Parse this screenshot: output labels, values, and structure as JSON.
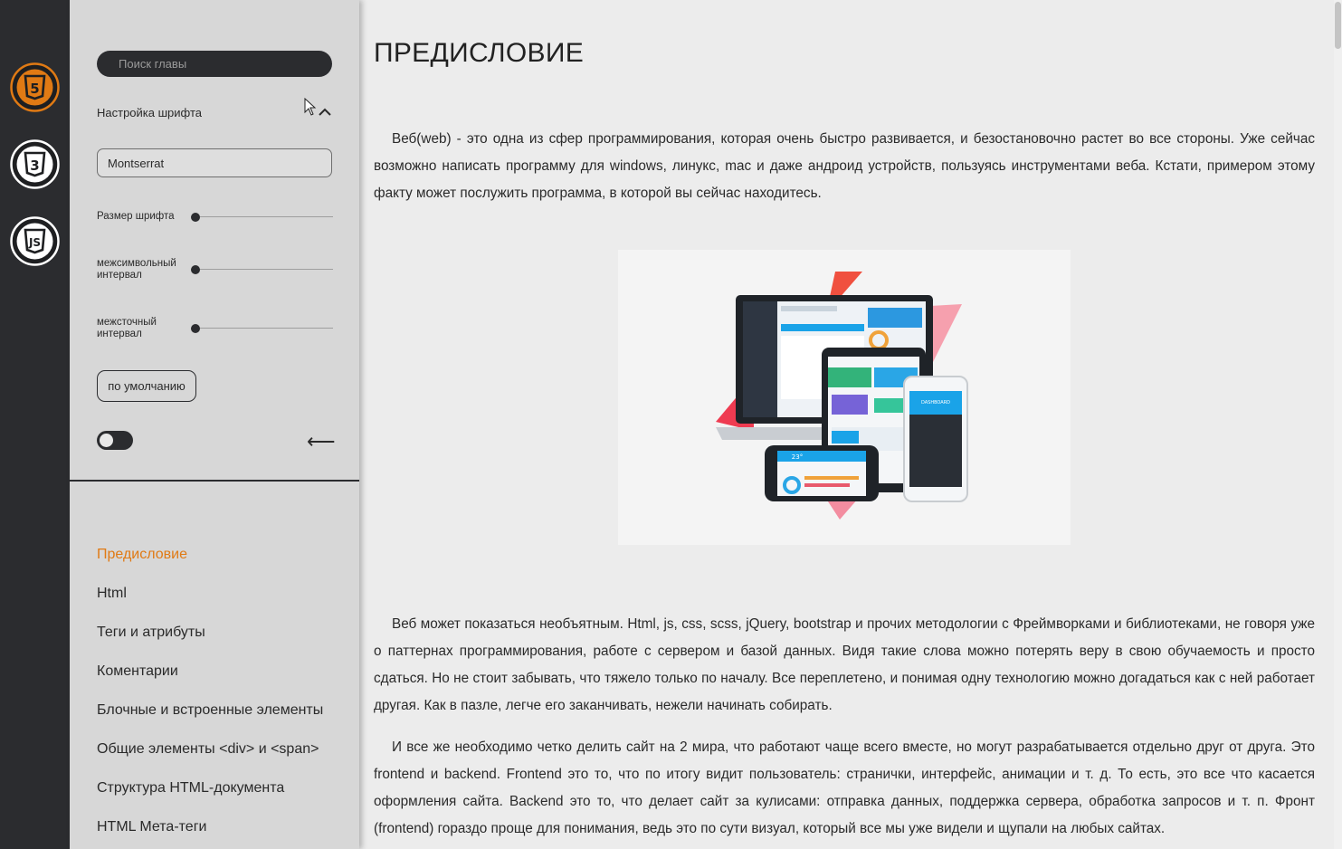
{
  "rail": {
    "icons": [
      {
        "name": "html5-icon",
        "label": "5",
        "color": "#e07a14"
      },
      {
        "name": "css3-icon",
        "label": "3",
        "color": "#ffffff"
      },
      {
        "name": "javascript-icon",
        "label": "JS",
        "color": "#ffffff"
      }
    ]
  },
  "panel": {
    "search_placeholder": "Поиск главы",
    "font_settings_label": "Настройка шрифта",
    "font_family_value": "Montserrat",
    "font_size_label": "Размер шрифта",
    "letter_spacing_label": "межсимвольный интервал",
    "line_height_label": "межсточный интервал",
    "font_size_level": 0,
    "letter_spacing_level": 0,
    "line_height_level": 0,
    "reset_label": "по умолчанию",
    "theme_toggle_on": false,
    "collapse_glyph": "⟵"
  },
  "chapters": [
    {
      "label": "Предисловие",
      "active": true
    },
    {
      "label": "Html",
      "active": false
    },
    {
      "label": "Теги и атрибуты",
      "active": false
    },
    {
      "label": "Коментарии",
      "active": false
    },
    {
      "label": "Блочные и встроенные элементы",
      "active": false
    },
    {
      "label": "Общие элементы <div> и <span>",
      "active": false
    },
    {
      "label": "Структура HTML-документа",
      "active": false
    },
    {
      "label": "HTML Мета-теги",
      "active": false
    }
  ],
  "content": {
    "title": "ПРЕДИСЛОВИЕ",
    "paragraphs": [
      "Веб(web) - это одна из сфер программирования, которая очень быстро развивается, и безостановочно растет во все стороны. Уже сейчас возможно написать программу для windows, линукс, mac и даже андроид устройств, пользуясь инструментами веба. Кстати, примером этому факту может послужить программа, в которой вы сейчас находитесь.",
      "Веб может показаться необъятным. Html, js, css, scss, jQuery, bootstrap и прочих методологии с Фреймворками и библиотеками, не говоря уже о паттернах программирования, работе с сервером и базой данных. Видя такие слова можно потерять веру в свою обучаемость и просто сдаться. Но не стоит забывать, что тяжело только по началу. Все переплетено, и понимая одну технологию можно догадаться как с ней работает другая. Как в пазле, легче его заканчивать, нежели начинать собирать.",
      "И все же необходимо четко делить сайт на 2 мира, что работают чаще всего вместе, но могут разрабатывается отдельно друг от друга. Это frontend и backend. Frontend это то, что по итогу видит пользователь: странички, интерфейс, анимации и т. д. То есть, это все что касается оформления сайта. Backend это то, что делает сайт за кулисами: отправка данных, поддержка сервера, обработка запросов и т. п. Фронт (frontend) гораздо проще для понимания, ведь это по сути визуал, который все мы уже видели и щупали на любых сайтах."
    ],
    "hero_image": {
      "description": "responsive-devices-illustration",
      "dashboard_label": "DASHBOARD",
      "temperature_label": "23°"
    }
  },
  "colors": {
    "rail_bg": "#2b2c2f",
    "panel_bg": "#d7d7d7",
    "content_bg": "#ececec",
    "accent": "#e07a14"
  }
}
